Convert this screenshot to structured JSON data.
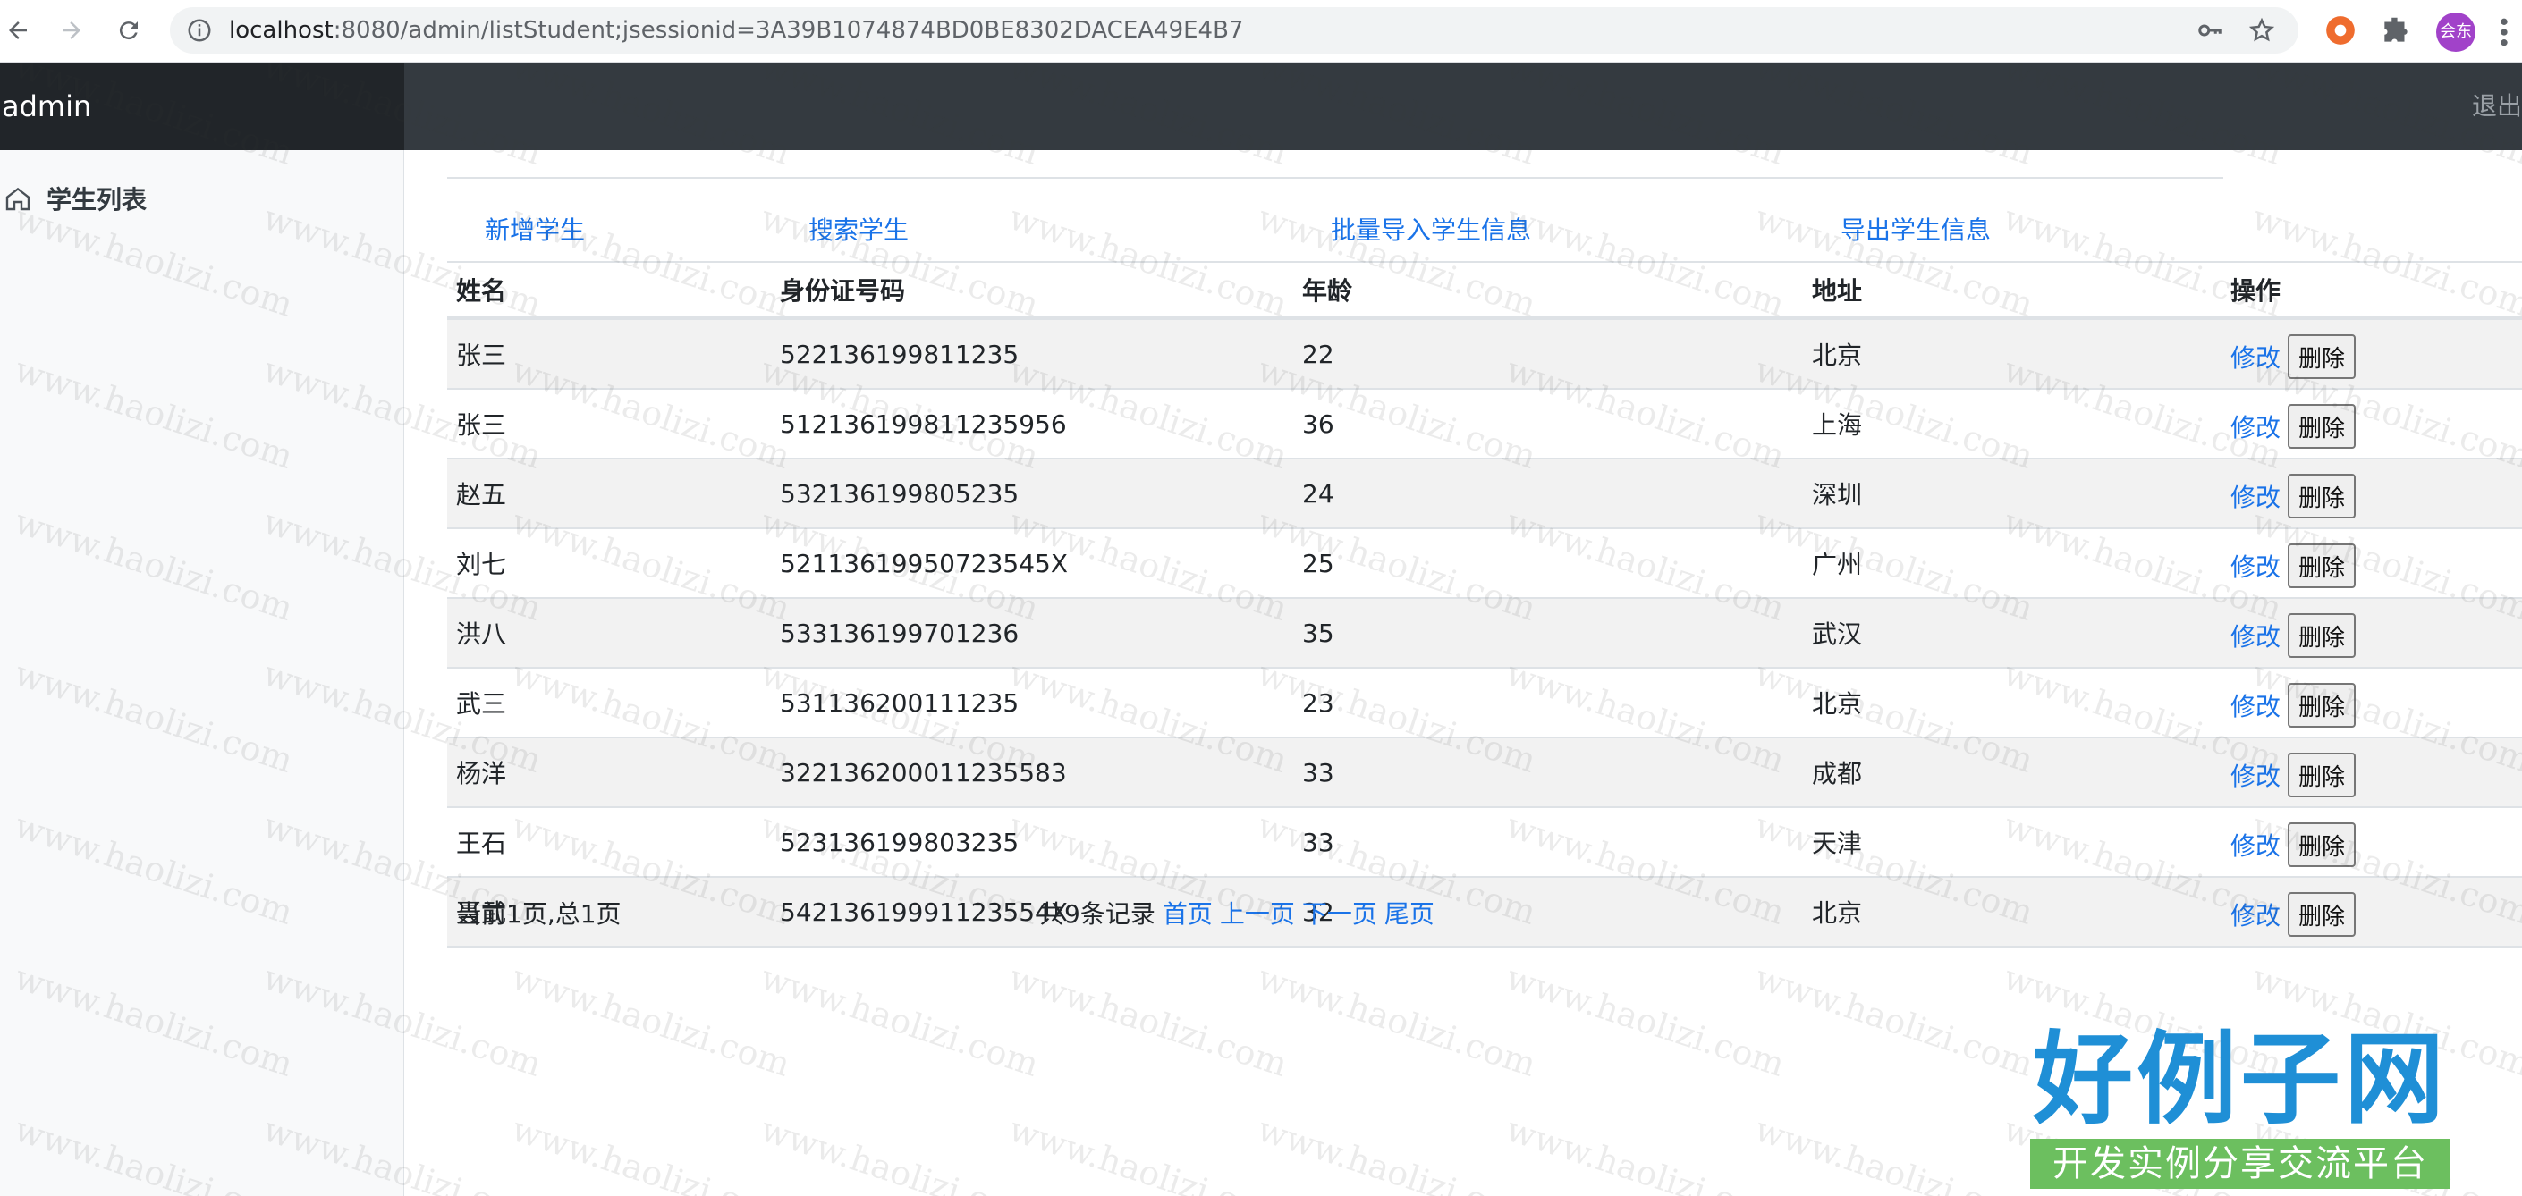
{
  "browser": {
    "url_host": "localhost",
    "url_rest": ":8080/admin/listStudent;jsessionid=3A39B1074874BD0BE8302DACEA49E4B7",
    "profile_label": "会东"
  },
  "header": {
    "brand": "admin",
    "logout": "退出"
  },
  "sidebar": {
    "items": [
      {
        "label": "学生列表",
        "icon": "home-icon"
      }
    ]
  },
  "actions": {
    "add": "新增学生",
    "search": "搜索学生",
    "import": "批量导入学生信息",
    "export": "导出学生信息"
  },
  "table": {
    "headers": [
      "姓名",
      "身份证号码",
      "年龄",
      "地址",
      "操作"
    ],
    "edit_label": "修改",
    "delete_label": "删除",
    "rows": [
      {
        "name": "张三",
        "id_no": "522136199811235",
        "age": "22",
        "addr": "北京"
      },
      {
        "name": "张三",
        "id_no": "512136199811235956",
        "age": "36",
        "addr": "上海"
      },
      {
        "name": "赵五",
        "id_no": "532136199805235",
        "age": "24",
        "addr": "深圳"
      },
      {
        "name": "刘七",
        "id_no": "52113619950723545X",
        "age": "25",
        "addr": "广州"
      },
      {
        "name": "洪八",
        "id_no": "533136199701236",
        "age": "35",
        "addr": "武汉"
      },
      {
        "name": "武三",
        "id_no": "531136200111235",
        "age": "23",
        "addr": "北京"
      },
      {
        "name": "杨洋",
        "id_no": "322136200011235583",
        "age": "33",
        "addr": "成都"
      },
      {
        "name": "王石",
        "id_no": "523136199803235",
        "age": "33",
        "addr": "天津"
      },
      {
        "name": "聂武",
        "id_no": "54213619991123554X",
        "age": "32",
        "addr": "北京"
      }
    ]
  },
  "pager": {
    "status": "当前1页,总1页",
    "total": "共9条记录",
    "first": "首页",
    "prev": "上一页",
    "next": "下一页",
    "last": "尾页"
  },
  "watermark": {
    "text": "www.haolizi.com",
    "logo_main": "好例子网",
    "logo_sub": "开发实例分享交流平台"
  }
}
